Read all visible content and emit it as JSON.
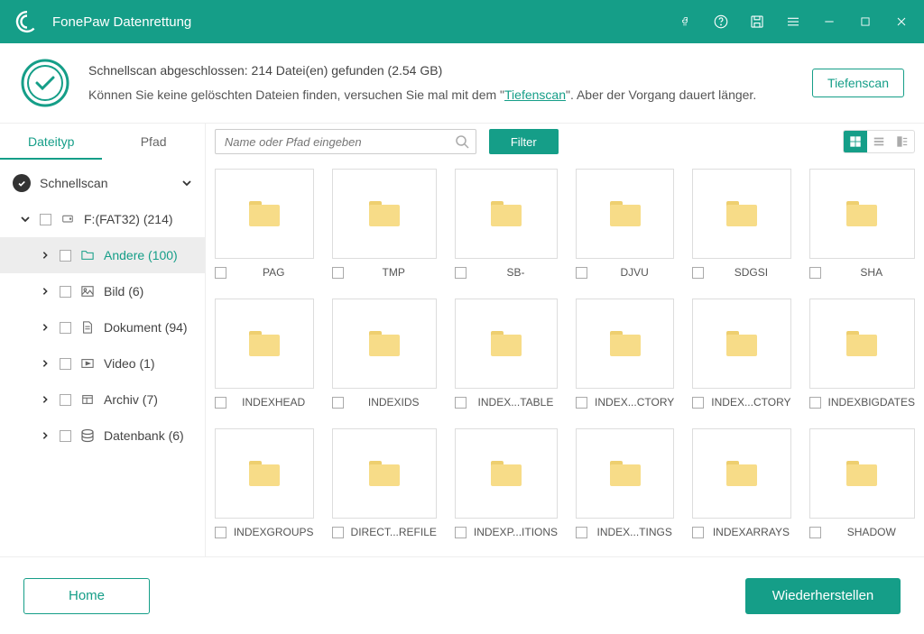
{
  "titlebar": {
    "title": "FonePaw Datenrettung"
  },
  "status": {
    "line1": "Schnellscan abgeschlossen: 214 Datei(en) gefunden (2.54 GB)",
    "line2_a": "Können Sie keine gelöschten Dateien finden, versuchen Sie mal mit dem \"",
    "deep_link": "Tiefenscan",
    "line2_b": "\". Aber der Vorgang dauert länger.",
    "deep_button": "Tiefenscan"
  },
  "sidebar": {
    "tabs": {
      "type": "Dateityp",
      "path": "Pfad"
    },
    "root": "Schnellscan",
    "drive": "F:(FAT32) (214)",
    "cats": [
      {
        "label": "Andere (100)",
        "icon": "folder",
        "selected": true
      },
      {
        "label": "Bild (6)",
        "icon": "image"
      },
      {
        "label": "Dokument (94)",
        "icon": "doc"
      },
      {
        "label": "Video (1)",
        "icon": "video"
      },
      {
        "label": "Archiv (7)",
        "icon": "archive"
      },
      {
        "label": "Datenbank (6)",
        "icon": "db"
      }
    ]
  },
  "toolbar": {
    "search_placeholder": "Name oder Pfad eingeben",
    "filter": "Filter"
  },
  "items": [
    {
      "name": "PAG"
    },
    {
      "name": "TMP"
    },
    {
      "name": "SB-"
    },
    {
      "name": "DJVU"
    },
    {
      "name": "SDGSI"
    },
    {
      "name": "SHA"
    },
    {
      "name": "INDEXHEAD"
    },
    {
      "name": "INDEXIDS"
    },
    {
      "name": "INDEX...TABLE"
    },
    {
      "name": "INDEX...CTORY"
    },
    {
      "name": "INDEX...CTORY"
    },
    {
      "name": "INDEXBIGDATES"
    },
    {
      "name": "INDEXGROUPS"
    },
    {
      "name": "DIRECT...REFILE"
    },
    {
      "name": "INDEXP...ITIONS"
    },
    {
      "name": "INDEX...TINGS"
    },
    {
      "name": "INDEXARRAYS"
    },
    {
      "name": "SHADOW"
    }
  ],
  "footer": {
    "home": "Home",
    "recover": "Wiederherstellen"
  }
}
